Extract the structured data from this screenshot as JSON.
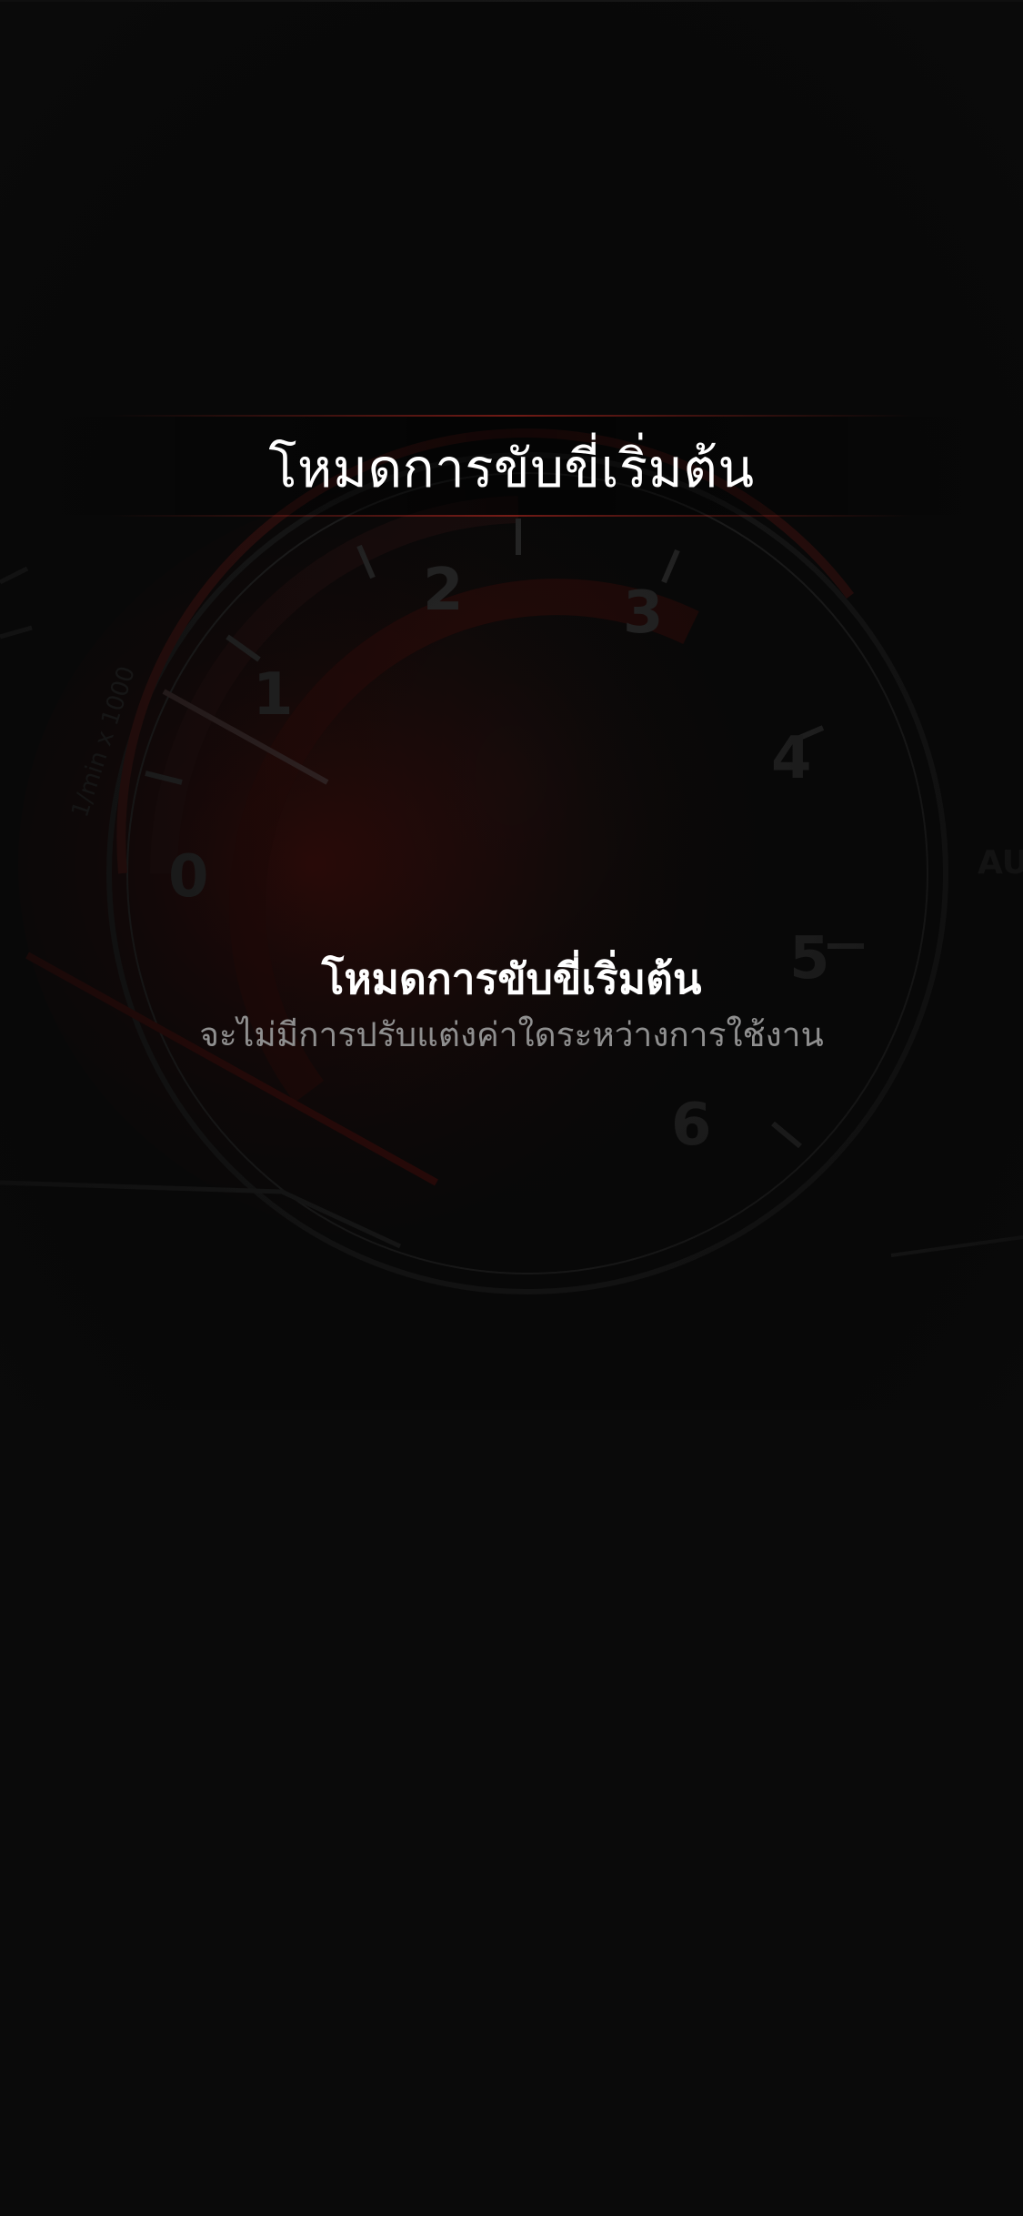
{
  "header": {
    "title": "โหมดการขับขี่เริ่มต้น"
  },
  "info": {
    "title": "โหมดการขับขี่เริ่มต้น",
    "subtitle": "จะไม่มีการปรับแต่งค่าใดระหว่างการใช้งาน"
  },
  "gauge": {
    "unit_label": "1/min x 1000",
    "ticks": [
      "0",
      "1",
      "2",
      "3",
      "4",
      "5",
      "6"
    ]
  },
  "colors": {
    "background": "#0a0a0a",
    "accent_red": "#b3261e",
    "title_text": "#ffffff",
    "subtitle_text": "#8f8f8f"
  }
}
